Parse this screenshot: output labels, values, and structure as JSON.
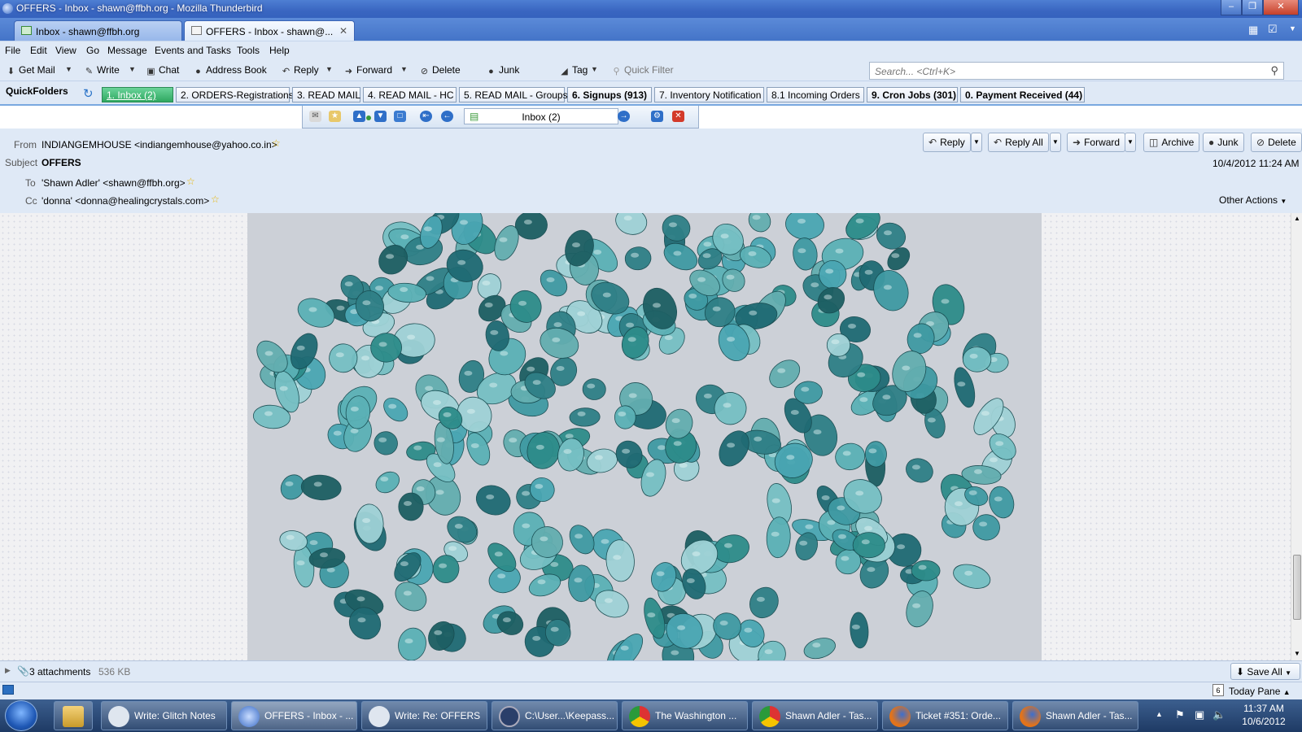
{
  "window": {
    "title": "OFFERS - Inbox - shawn@ffbh.org - Mozilla Thunderbird"
  },
  "tabs": [
    {
      "label": "Inbox - shawn@ffbh.org"
    },
    {
      "label": "OFFERS - Inbox - shawn@..."
    }
  ],
  "menu": [
    "File",
    "Edit",
    "View",
    "Go",
    "Message",
    "Events and Tasks",
    "Tools",
    "Help"
  ],
  "toolbar": {
    "get_mail": "Get Mail",
    "write": "Write",
    "chat": "Chat",
    "address_book": "Address Book",
    "reply": "Reply",
    "forward": "Forward",
    "delete": "Delete",
    "junk": "Junk",
    "tag": "Tag",
    "quick_filter": "Quick Filter",
    "search_placeholder": "Search... <Ctrl+K>"
  },
  "quickfolders": {
    "label": "QuickFolders",
    "items": [
      "1. Inbox (2)",
      "2. ORDERS-Registrations",
      "3. READ MAIL",
      "4. READ MAIL - HC",
      "5. READ MAIL - Groups",
      "6. Signups (913)",
      "7. Inventory Notification",
      "8.1 Incoming Orders",
      "9. Cron Jobs (301)",
      "0. Payment Received (44)"
    ]
  },
  "navbar": {
    "folder": "Inbox (2)"
  },
  "message": {
    "from_label": "From",
    "from": "INDIANGEMHOUSE <indiangemhouse@yahoo.co.in>",
    "subject_label": "Subject",
    "subject": "OFFERS",
    "to_label": "To",
    "to": "'Shawn Adler' <shawn@ffbh.org>",
    "cc_label": "Cc",
    "cc": "'donna' <donna@healingcrystals.com>",
    "date": "10/4/2012 11:24 AM",
    "other_actions": "Other Actions"
  },
  "header_buttons": {
    "reply": "Reply",
    "reply_all": "Reply All",
    "forward": "Forward",
    "archive": "Archive",
    "junk": "Junk",
    "delete": "Delete"
  },
  "attachments": {
    "count": "3 attachments",
    "size": "536 KB",
    "save_all": "Save All"
  },
  "status": {
    "today_pane": "Today Pane",
    "calendar_day": "6"
  },
  "taskbar": {
    "items": [
      "Write: Glitch Notes",
      "OFFERS - Inbox - ...",
      "Write: Re: OFFERS",
      "C:\\User...\\Keepass...",
      "The Washington ...",
      "Shawn Adler - Tas...",
      "Ticket #351: Orde...",
      "Shawn Adler - Tas..."
    ],
    "time": "11:37 AM",
    "date": "10/6/2012"
  }
}
